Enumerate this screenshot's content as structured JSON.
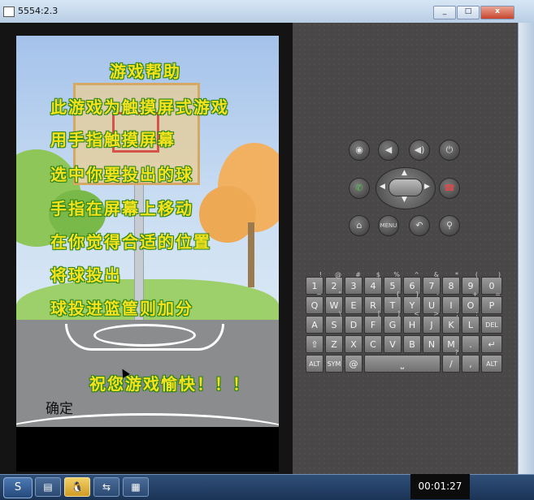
{
  "window": {
    "title": "5554:2.3",
    "minimize_label": "_",
    "maximize_label": "□",
    "close_label": "x"
  },
  "game_screen": {
    "help_title": "游戏帮助",
    "help_lines": [
      "此游戏为触摸屏式游戏",
      "用手指触摸屏幕",
      "选中你要投出的球",
      "手指在屏幕上移动",
      "在你觉得合适的位置",
      "将球投出",
      "球投进篮筐则加分"
    ],
    "wish_text": "祝您游戏愉快！！！",
    "ok_button": "确定"
  },
  "hardware_buttons": {
    "camera": "◉",
    "volume_down": "◀",
    "volume_up": "◀)",
    "power": "⏻",
    "call": "✆",
    "end_call": "☎",
    "home": "⌂",
    "menu": "MENU",
    "back": "↶",
    "search": "⚲"
  },
  "keyboard": {
    "rows": [
      [
        {
          "k": "1",
          "a": "!"
        },
        {
          "k": "2",
          "a": "@"
        },
        {
          "k": "3",
          "a": "#"
        },
        {
          "k": "4",
          "a": "$"
        },
        {
          "k": "5",
          "a": "%"
        },
        {
          "k": "6",
          "a": "^"
        },
        {
          "k": "7",
          "a": "&"
        },
        {
          "k": "8",
          "a": "*"
        },
        {
          "k": "9",
          "a": "("
        },
        {
          "k": "0",
          "a": ")"
        }
      ],
      [
        {
          "k": "Q",
          "a": "~"
        },
        {
          "k": "W",
          "a": "\""
        },
        {
          "k": "E",
          "a": ""
        },
        {
          "k": "R",
          "a": ""
        },
        {
          "k": "T",
          "a": "{"
        },
        {
          "k": "Y",
          "a": "}"
        },
        {
          "k": "U",
          "a": "-"
        },
        {
          "k": "I",
          "a": ""
        },
        {
          "k": "O",
          "a": "+"
        },
        {
          "k": "P",
          "a": "="
        }
      ],
      [
        {
          "k": "A",
          "a": ""
        },
        {
          "k": "S",
          "a": "\\"
        },
        {
          "k": "D",
          "a": ""
        },
        {
          "k": "F",
          "a": "["
        },
        {
          "k": "G",
          "a": "]"
        },
        {
          "k": "H",
          "a": "<"
        },
        {
          "k": "J",
          "a": ">"
        },
        {
          "k": "K",
          "a": ";"
        },
        {
          "k": "L",
          "a": ":"
        },
        {
          "k": "DEL",
          "a": ""
        }
      ],
      [
        {
          "k": "⇧",
          "a": ""
        },
        {
          "k": "Z",
          "a": ""
        },
        {
          "k": "X",
          "a": ""
        },
        {
          "k": "C",
          "a": ""
        },
        {
          "k": "V",
          "a": ""
        },
        {
          "k": "B",
          "a": ""
        },
        {
          "k": "N",
          "a": ""
        },
        {
          "k": "M",
          "a": ""
        },
        {
          "k": ".",
          "a": ""
        },
        {
          "k": "↵",
          "a": ""
        }
      ],
      [
        {
          "k": "ALT",
          "a": ""
        },
        {
          "k": "SYM",
          "a": ""
        },
        {
          "k": "@",
          "a": ""
        },
        {
          "k": "⎵",
          "a": ""
        },
        {
          "k": "/",
          "a": "?"
        },
        {
          "k": ",",
          "a": ""
        },
        {
          "k": "ALT",
          "a": ""
        }
      ]
    ]
  },
  "taskbar": {
    "start_icon": "S",
    "items": [
      "▤",
      "🐧",
      "⇆",
      "▦"
    ],
    "clock": "00:01:27"
  }
}
